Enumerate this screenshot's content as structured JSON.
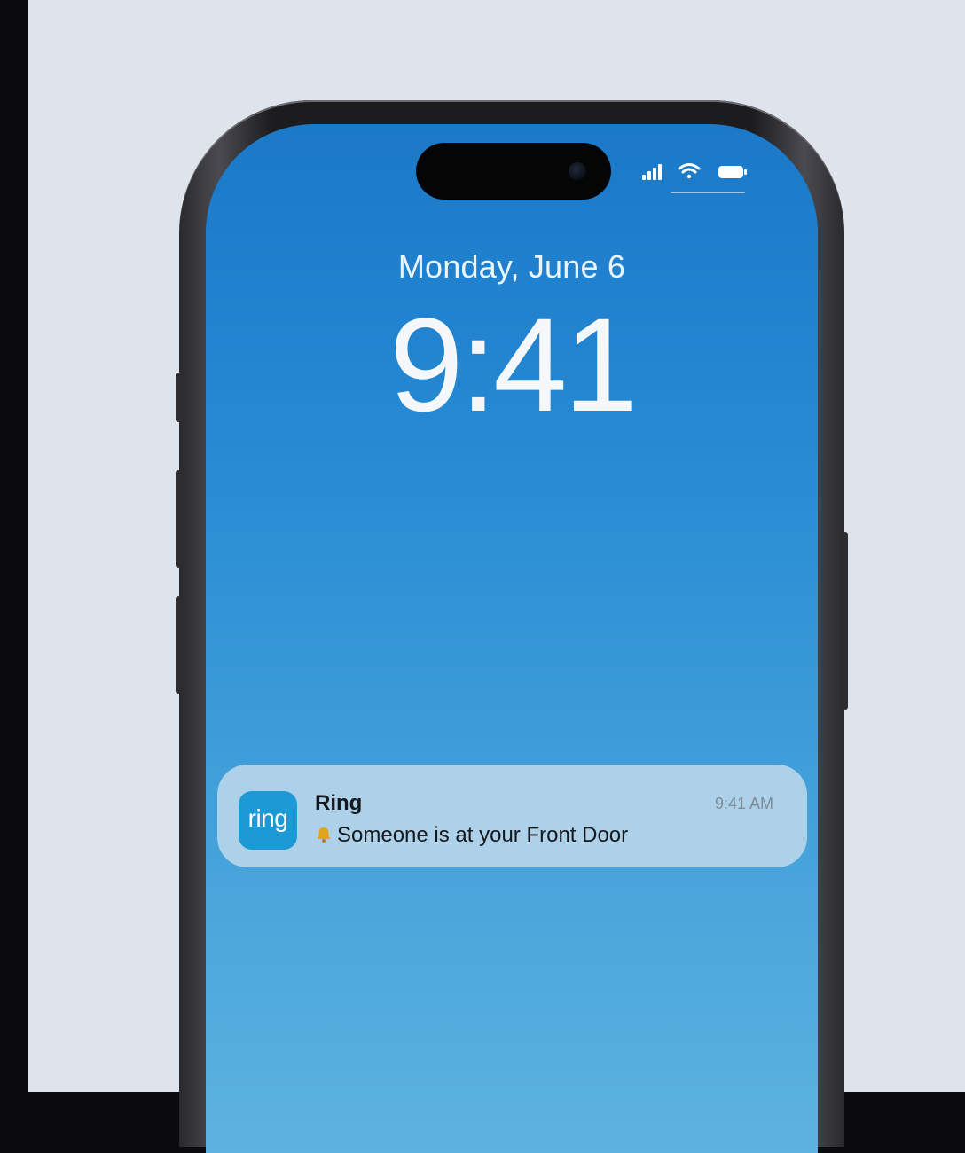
{
  "lock_screen": {
    "date": "Monday, June 6",
    "time": "9:41"
  },
  "notification": {
    "app_name": "Ring",
    "app_icon_label": "ring",
    "timestamp": "9:41 AM",
    "icon": "bell-alert-icon",
    "message": "Someone is at your Front Door"
  },
  "status_bar": {
    "icons": [
      "cellular-signal-icon",
      "wifi-icon",
      "battery-icon"
    ]
  },
  "colors": {
    "wallpaper_top": "#1b79c8",
    "wallpaper_bottom": "#5db3df",
    "ring_brand": "#1c9ad6",
    "alert_bell": "#e0a418",
    "page_background": "#dfe3ec"
  }
}
